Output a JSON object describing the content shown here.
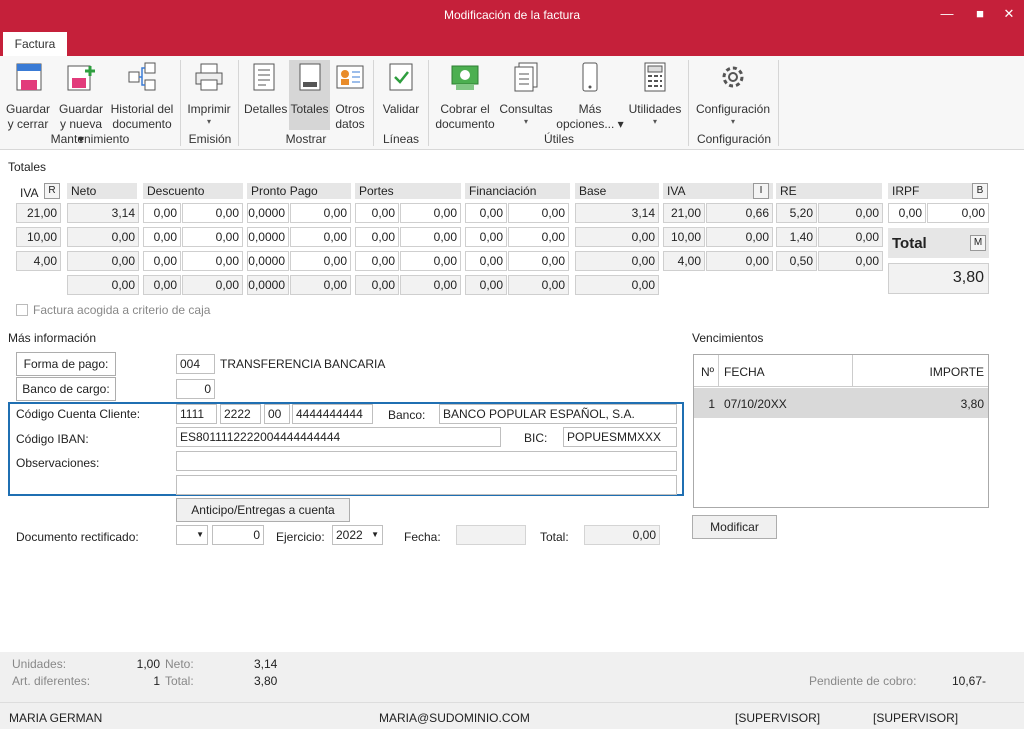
{
  "window": {
    "title": "Modificación de la factura",
    "min": "—",
    "max": "■",
    "close": "✕"
  },
  "tab": "Factura",
  "ribbon": {
    "buttons": {
      "guardar_cerrar": [
        "Guardar",
        "y cerrar"
      ],
      "guardar_nueva": [
        "Guardar",
        "y nueva ▾"
      ],
      "historial": [
        "Historial del",
        "documento"
      ],
      "imprimir": [
        "Imprimir",
        "▾"
      ],
      "detalles": [
        "Detalles",
        ""
      ],
      "totales": [
        "Totales",
        ""
      ],
      "otros": [
        "Otros",
        "datos"
      ],
      "validar": [
        "Validar",
        ""
      ],
      "cobrar": [
        "Cobrar el",
        "documento"
      ],
      "consultas": [
        "Consultas",
        "▾"
      ],
      "mas_opciones": [
        "Más",
        "opciones... ▾"
      ],
      "utilidades": [
        "Utilidades",
        "▾"
      ],
      "configuracion": [
        "Configuración",
        "▾"
      ]
    },
    "groups": {
      "mantenimiento": "Mantenimiento",
      "emision": "Emisión",
      "mostrar": "Mostrar",
      "lineas": "Líneas",
      "utiles": "Útiles",
      "configuracion": "Configuración"
    }
  },
  "totales": {
    "section_title": "Totales",
    "headers": {
      "iva": "IVA",
      "iva_btn": "R",
      "neto": "Neto",
      "descuento": "Descuento",
      "pronto_pago": "Pronto Pago",
      "portes": "Portes",
      "financiacion": "Financiación",
      "base": "Base",
      "iva2": "IVA",
      "iva2_btn": "I",
      "re": "RE",
      "irpf": "IRPF",
      "irpf_btn": "B"
    },
    "rows": [
      {
        "iva": "21,00",
        "neto": "3,14",
        "d1": "0,00",
        "d2": "0,00",
        "p1": "0,0000",
        "p2": "0,00",
        "po1": "0,00",
        "po2": "0,00",
        "f1": "0,00",
        "f2": "0,00",
        "base": "3,14",
        "iva_pct": "21,00",
        "iva_val": "0,66",
        "re_pct": "5,20",
        "re_val": "0,00"
      },
      {
        "iva": "10,00",
        "neto": "0,00",
        "d1": "0,00",
        "d2": "0,00",
        "p1": "0,0000",
        "p2": "0,00",
        "po1": "0,00",
        "po2": "0,00",
        "f1": "0,00",
        "f2": "0,00",
        "base": "0,00",
        "iva_pct": "10,00",
        "iva_val": "0,00",
        "re_pct": "1,40",
        "re_val": "0,00"
      },
      {
        "iva": "4,00",
        "neto": "0,00",
        "d1": "0,00",
        "d2": "0,00",
        "p1": "0,0000",
        "p2": "0,00",
        "po1": "0,00",
        "po2": "0,00",
        "f1": "0,00",
        "f2": "0,00",
        "base": "0,00",
        "iva_pct": "4,00",
        "iva_val": "0,00",
        "re_pct": "0,50",
        "re_val": "0,00"
      },
      {
        "iva": "",
        "neto": "0,00",
        "d1": "0,00",
        "d2": "0,00",
        "p1": "0,0000",
        "p2": "0,00",
        "po1": "0,00",
        "po2": "0,00",
        "f1": "0,00",
        "f2": "0,00",
        "base": "0,00"
      }
    ],
    "irpf": {
      "pct": "0,00",
      "val": "0,00"
    },
    "total_label": "Total",
    "total_btn": "M",
    "total_value": "3,80",
    "criterio_caja": "Factura acogida a criterio de caja"
  },
  "mas_info": {
    "title": "Más información",
    "forma_pago_btn": "Forma de pago:",
    "forma_pago_code": "004",
    "forma_pago_desc": "TRANSFERENCIA BANCARIA",
    "banco_cargo_btn": "Banco de cargo:",
    "banco_cargo_val": "0",
    "ccc_label": "Código Cuenta Cliente:",
    "ccc": [
      "1111",
      "2222",
      "00",
      "4444444444"
    ],
    "banco_label": "Banco:",
    "banco_val": "BANCO POPULAR ESPAÑOL, S.A.",
    "iban_label": "Código IBAN:",
    "iban_val": "ES8011112222004444444444",
    "bic_label": "BIC:",
    "bic_val": "POPUESMMXXX",
    "obs_label": "Observaciones:",
    "anticipo_btn": "Anticipo/Entregas a cuenta",
    "doc_rect_label": "Documento rectificado:",
    "doc_rect_val": "0",
    "ejercicio_label": "Ejercicio:",
    "ejercicio_val": "2022",
    "fecha_label": "Fecha:",
    "total_label": "Total:",
    "total_val": "0,00"
  },
  "vencimientos": {
    "title": "Vencimientos",
    "headers": {
      "n": "Nº",
      "fecha": "FECHA",
      "importe": "IMPORTE"
    },
    "rows": [
      {
        "n": "1",
        "fecha": "07/10/20XX",
        "importe": "3,80"
      }
    ],
    "modificar_btn": "Modificar"
  },
  "summary": {
    "unidades_label": "Unidades:",
    "unidades": "1,00",
    "art_label": "Art. diferentes:",
    "art": "1",
    "neto_label": "Neto:",
    "neto": "3,14",
    "total_label": "Total:",
    "total": "3,80",
    "pendiente_label": "Pendiente de cobro:",
    "pendiente": "10,67-"
  },
  "status": {
    "user": "MARIA GERMAN",
    "email": "MARIA@SUDOMINIO.COM",
    "role1": "[SUPERVISOR]",
    "role2": "[SUPERVISOR]"
  },
  "colors": {
    "accent": "#c5203a",
    "highlight_border": "#1f6fb2"
  }
}
